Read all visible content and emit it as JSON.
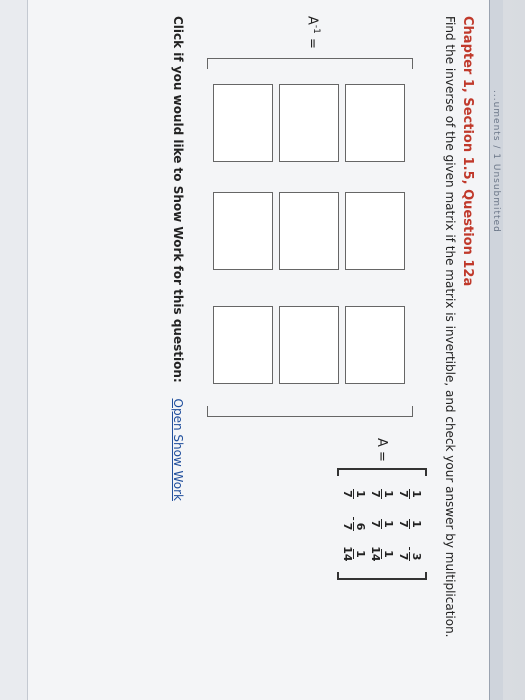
{
  "header": {
    "strip_text": "...uments / 1 Unsubmitted"
  },
  "question": {
    "heading": "Chapter 1, Section 1.5, Question 12a",
    "prompt": "Find the inverse of the given matrix if the matrix is invertible, and check your answer by multiplication."
  },
  "matrix_a": {
    "label": "A =",
    "rows": [
      [
        {
          "sign": "",
          "num": "1",
          "den": "7"
        },
        {
          "sign": "",
          "num": "1",
          "den": "7"
        },
        {
          "sign": "-",
          "num": "3",
          "den": "7"
        }
      ],
      [
        {
          "sign": "",
          "num": "1",
          "den": "7"
        },
        {
          "sign": "",
          "num": "1",
          "den": "7"
        },
        {
          "sign": "",
          "num": "1",
          "den": "14"
        }
      ],
      [
        {
          "sign": "",
          "num": "1",
          "den": "7"
        },
        {
          "sign": "-",
          "num": "6",
          "den": "7"
        },
        {
          "sign": "",
          "num": "1",
          "den": "14"
        }
      ]
    ]
  },
  "inverse": {
    "label": "A",
    "superscript": "-1",
    "equals": "=",
    "cells": [
      [
        "",
        "",
        ""
      ],
      [
        "",
        "",
        ""
      ],
      [
        "",
        "",
        ""
      ]
    ]
  },
  "show_work": {
    "prompt": "Click if you would like to Show Work for this question:",
    "link": "Open Show Work"
  },
  "colors": {
    "heading": "#c0392b",
    "link": "#1f4e9c"
  }
}
